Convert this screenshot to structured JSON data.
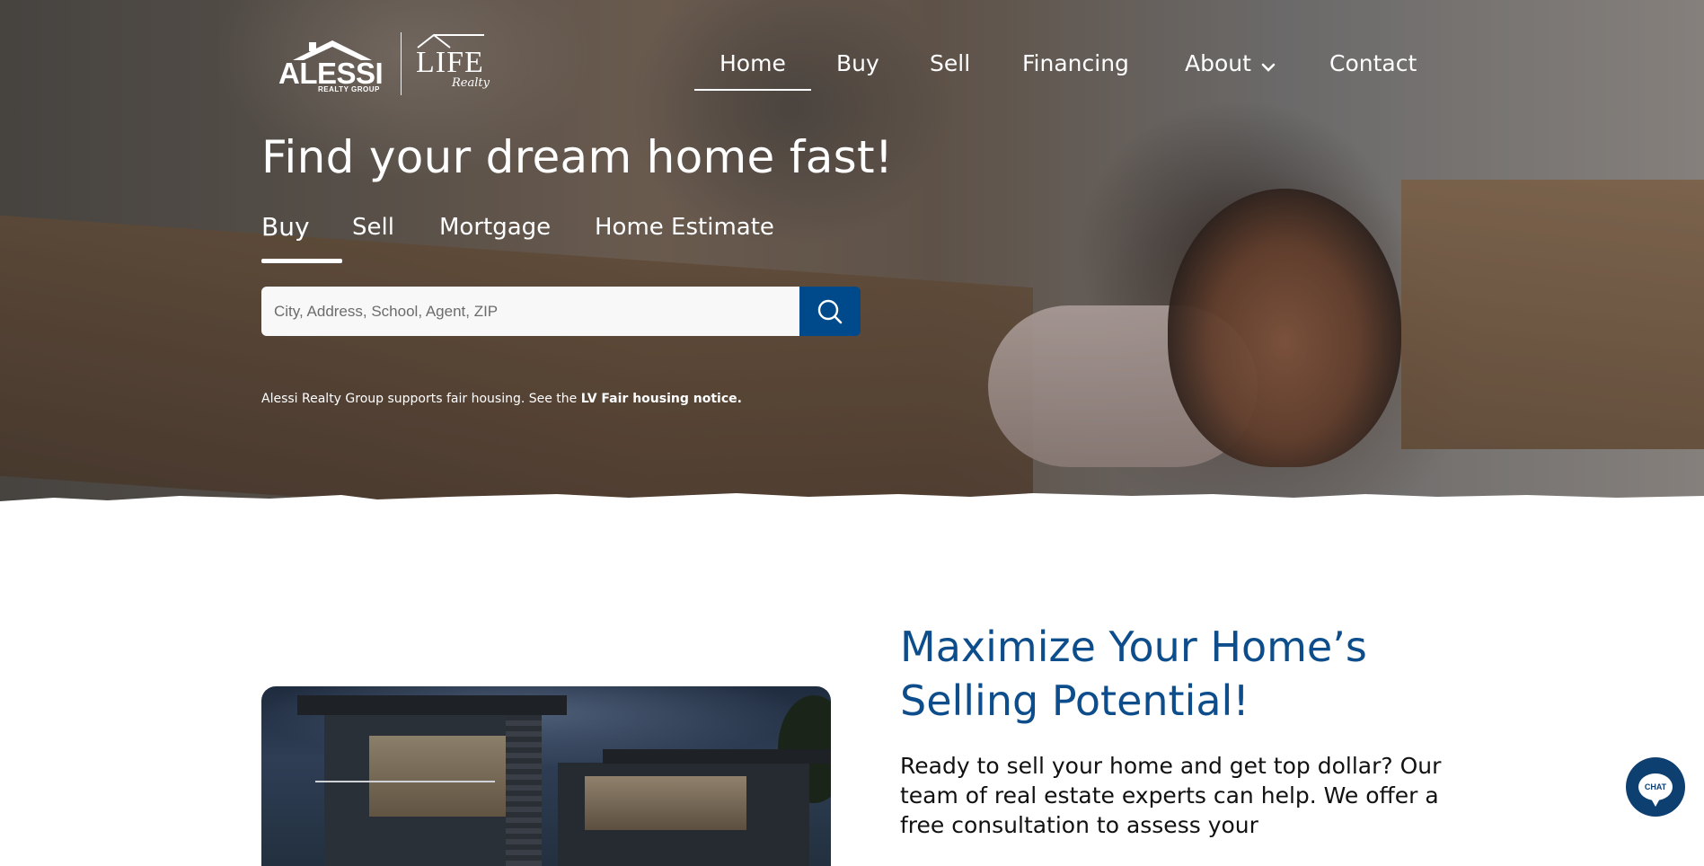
{
  "logo": {
    "brand": "ALESSI",
    "brand_sub": "REALTY GROUP",
    "partner": "LIFE",
    "partner_script": "Realty"
  },
  "nav": {
    "items": [
      {
        "label": "Home",
        "active": true
      },
      {
        "label": "Buy"
      },
      {
        "label": "Sell"
      },
      {
        "label": "Financing"
      },
      {
        "label": "About",
        "has_dropdown": true
      },
      {
        "label": "Contact"
      }
    ]
  },
  "hero": {
    "title": "Find your dream home fast!",
    "tabs": [
      {
        "label": "Buy",
        "active": true
      },
      {
        "label": "Sell"
      },
      {
        "label": "Mortgage"
      },
      {
        "label": "Home Estimate"
      }
    ],
    "search_placeholder": "City, Address, School, Agent, ZIP",
    "search_value": "",
    "fair_housing_text": "Alessi Realty Group supports fair housing. See the ",
    "fair_housing_link": "LV Fair housing notice."
  },
  "promo": {
    "heading": "Maximize Your Home’s Selling Potential!",
    "body": "Ready to sell your home and get top dollar? Our team of real estate experts can help. We offer a free consultation to assess your"
  },
  "chat": {
    "label": "CHAT"
  },
  "colors": {
    "accent": "#0d4d8b",
    "search_button": "#004a8c",
    "chat_button": "#0d3f70"
  },
  "icons": {
    "search": "search-icon",
    "chevron": "chevron-down-icon",
    "chat": "chat-bubble-icon",
    "logo_roof": "house-roof-icon"
  }
}
